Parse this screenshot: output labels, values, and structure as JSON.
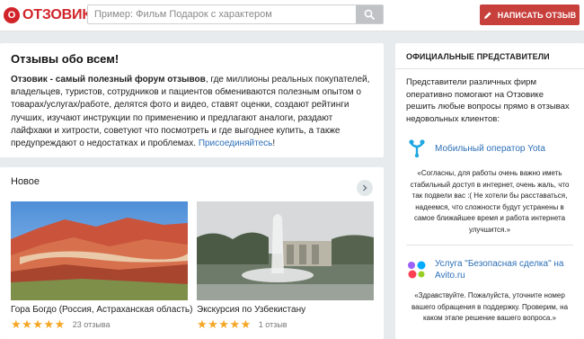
{
  "header": {
    "logo_letter": "О",
    "logo_text": "ОТЗОВИК",
    "search_placeholder": "Пример: Фильм Подарок с характером",
    "write_button": "НАПИСАТЬ ОТЗЫВ",
    "colors": {
      "brand": "#d1242a",
      "button": "#c7403c"
    }
  },
  "intro": {
    "title": "Отзывы обо всем!",
    "lead": "Отзовик - самый полезный форум отзывов",
    "body": ", где миллионы реальных покупателей, владельцев, туристов, сотрудников и пациентов обмениваются полезным опытом о товарах/услугах/работе, делятся фото и видео, ставят оценки, создают рейтинги лучших, изучают инструкции по применению и предлагают аналоги, раздают лайфхаки и хитрости, советуют что посмотреть и где выгоднее купить, а также предупреждают о недостатках и проблемах. ",
    "join_link": "Присоединяйтесь",
    "join_tail": "!"
  },
  "new_section": {
    "title": "Новое",
    "items": [
      {
        "caption": "Гора Богдо (Россия, Астраханская область)",
        "stars": "★★★★★",
        "rating": 4.5,
        "count": "23 отзыва",
        "icon": "mountain-photo"
      },
      {
        "caption": "Экскурсия по Узбекистану",
        "stars": "★★★★★",
        "rating": 5,
        "count": "1 отзыв",
        "icon": "fountain-photo"
      }
    ]
  },
  "reps": {
    "title": "ОФИЦИАЛЬНЫЕ ПРЕДСТАВИТЕЛИ",
    "description": "Представители различных фирм оперативно помогают на Отзовике решить любые вопросы прямо в отзывах недовольных клиентов:",
    "items": [
      {
        "name": "Мобильный оператор Yota",
        "icon": "yota-icon",
        "quote": "«Согласны, для работы очень важно иметь стабильный доступ в интернет, очень жаль, что так подвели вас :( Не хотели бы расставаться, надеемся, что сложности будут устранены в самое ближайшее время и работа интернета улучшится.»"
      },
      {
        "name": "Услуга \"Безопасная сделка\" на Avito.ru",
        "icon": "avito-icon",
        "quote": "«Здравствуйте. Пожалуйста, уточните номер вашего обращения в поддержку. Проверим, на каком этапе решение вашего вопроса.»"
      }
    ]
  }
}
